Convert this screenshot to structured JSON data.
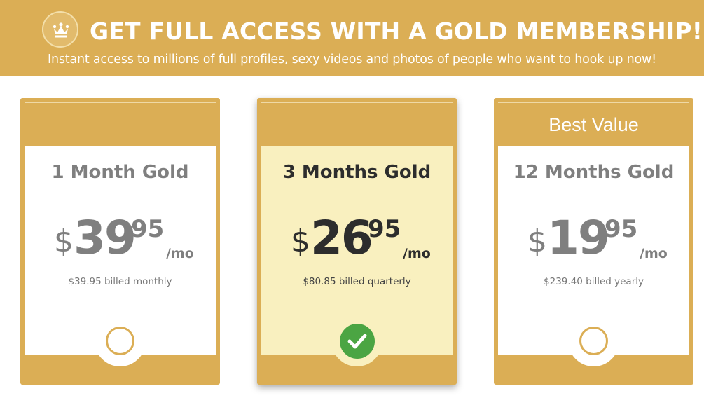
{
  "banner": {
    "title": "GET FULL ACCESS WITH A GOLD MEMBERSHIP!",
    "subtitle": "Instant access to millions of full profiles, sexy videos and photos of people who want to hook up now!",
    "icon": "crown-icon"
  },
  "colors": {
    "gold": "#dbae55",
    "selected_bg": "#f9f0bf",
    "check_green": "#4ba543",
    "muted_text": "#7f7f7f",
    "dark_text": "#2d2d2d"
  },
  "plans": [
    {
      "head_label": "",
      "name": "1 Month Gold",
      "currency": "$",
      "price_int": "39",
      "price_dec": "95",
      "per": "/mo",
      "billed": "$39.95 billed monthly",
      "selected": false
    },
    {
      "head_label": "",
      "name": "3 Months Gold",
      "currency": "$",
      "price_int": "26",
      "price_dec": "95",
      "per": "/mo",
      "billed": "$80.85 billed quarterly",
      "selected": true
    },
    {
      "head_label": "Best Value",
      "name": "12 Months Gold",
      "currency": "$",
      "price_int": "19",
      "price_dec": "95",
      "per": "/mo",
      "billed": "$239.40 billed yearly",
      "selected": false
    }
  ]
}
